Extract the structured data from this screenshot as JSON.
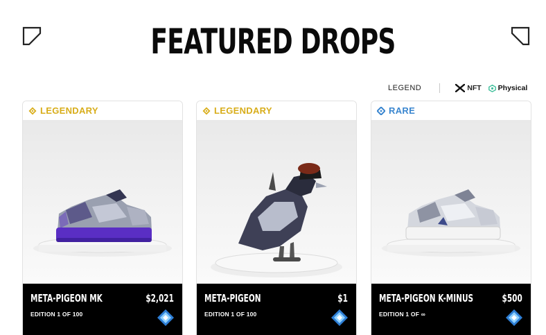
{
  "header": {
    "title": "FEATURED DROPS"
  },
  "legend": {
    "label": "LEGEND",
    "nft_label": "NFT",
    "physical_label": "Physical"
  },
  "cards": [
    {
      "rarity": "LEGENDARY",
      "name": "META-PIGEON MK",
      "price": "$2,021",
      "edition": "EDITION 1 OF 100"
    },
    {
      "rarity": "LEGENDARY",
      "name": "META-PIGEON",
      "price": "$1",
      "edition": "EDITION 1 OF 100"
    },
    {
      "rarity": "RARE",
      "name": "META-PIGEON K-MINUS",
      "price": "$500",
      "edition": "EDITION 1 OF ∞"
    }
  ],
  "colors": {
    "legendary": "#d8ad1a",
    "rare": "#3a86cf",
    "physical": "#3fbf9b",
    "card_footer": "#000000"
  },
  "icons": {
    "corner": "corner-bracket-icon",
    "nft": "x-nft-icon",
    "physical": "physical-icon",
    "legendary": "legendary-gem-icon",
    "rare": "rare-gem-icon",
    "token": "token-diamond-icon"
  }
}
